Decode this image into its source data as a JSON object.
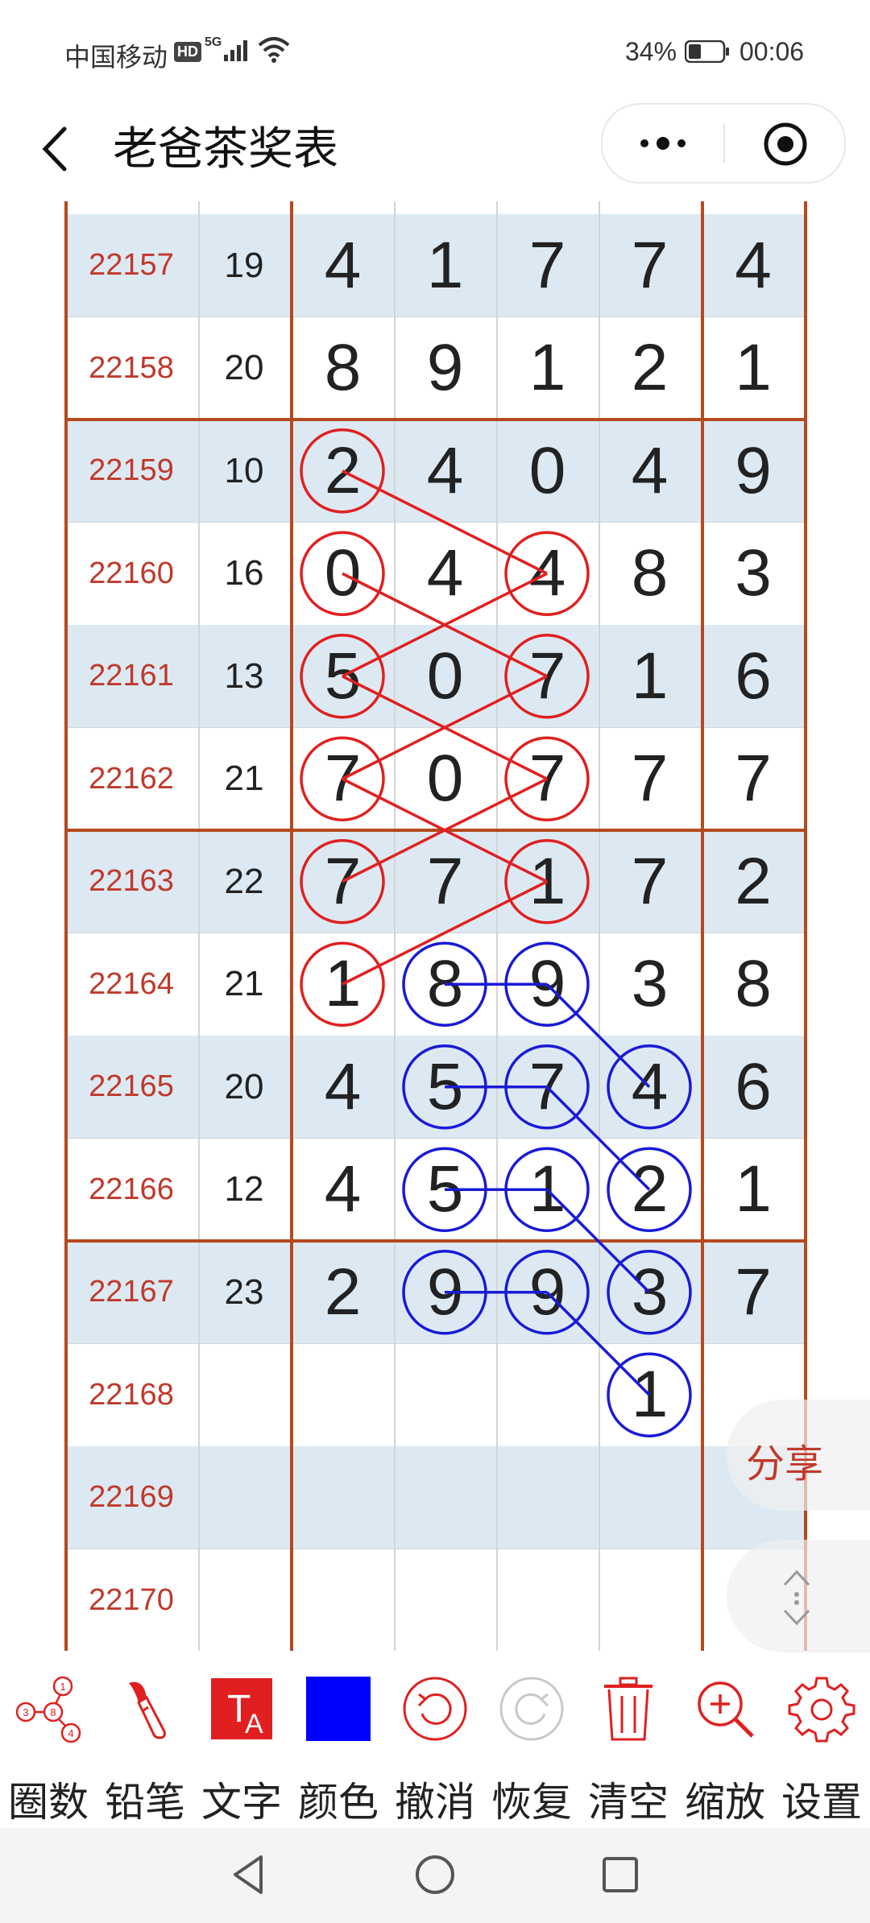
{
  "status_bar": {
    "carrier": "中国移动",
    "hd": "HD",
    "network": "5G",
    "battery_pct": "34%",
    "time": "00:06"
  },
  "title_bar": {
    "title": "老爸茶奖表"
  },
  "rows": [
    {
      "period": "22157",
      "sum": "19",
      "digits": [
        "4",
        "1",
        "7",
        "7"
      ],
      "extra": "4"
    },
    {
      "period": "22158",
      "sum": "20",
      "digits": [
        "8",
        "9",
        "1",
        "2"
      ],
      "extra": "1"
    },
    {
      "period": "22159",
      "sum": "10",
      "digits": [
        "2",
        "4",
        "0",
        "4"
      ],
      "extra": "9"
    },
    {
      "period": "22160",
      "sum": "16",
      "digits": [
        "0",
        "4",
        "4",
        "8"
      ],
      "extra": "3"
    },
    {
      "period": "22161",
      "sum": "13",
      "digits": [
        "5",
        "0",
        "7",
        "1"
      ],
      "extra": "6"
    },
    {
      "period": "22162",
      "sum": "21",
      "digits": [
        "7",
        "0",
        "7",
        "7"
      ],
      "extra": "7"
    },
    {
      "period": "22163",
      "sum": "22",
      "digits": [
        "7",
        "7",
        "1",
        "7"
      ],
      "extra": "2"
    },
    {
      "period": "22164",
      "sum": "21",
      "digits": [
        "1",
        "8",
        "9",
        "3"
      ],
      "extra": "8"
    },
    {
      "period": "22165",
      "sum": "20",
      "digits": [
        "4",
        "5",
        "7",
        "4"
      ],
      "extra": "6"
    },
    {
      "period": "22166",
      "sum": "12",
      "digits": [
        "4",
        "5",
        "1",
        "2"
      ],
      "extra": "1"
    },
    {
      "period": "22167",
      "sum": "23",
      "digits": [
        "2",
        "9",
        "9",
        "3"
      ],
      "extra": "7"
    },
    {
      "period": "22168",
      "sum": "",
      "digits": [
        "",
        "",
        "",
        "1"
      ],
      "extra": ""
    },
    {
      "period": "22169",
      "sum": "",
      "digits": [
        "",
        "",
        "",
        ""
      ],
      "extra": ""
    },
    {
      "period": "22170",
      "sum": "",
      "digits": [
        "",
        "",
        "",
        ""
      ],
      "extra": ""
    }
  ],
  "floating": {
    "share_label": "分享"
  },
  "toolbar": [
    {
      "label": "圈数",
      "icon": "circle-numbers-icon"
    },
    {
      "label": "铅笔",
      "icon": "brush-icon"
    },
    {
      "label": "文字",
      "icon": "text-icon"
    },
    {
      "label": "颜色",
      "icon": "color-swatch-icon"
    },
    {
      "label": "撤消",
      "icon": "undo-icon"
    },
    {
      "label": "恢复",
      "icon": "redo-icon"
    },
    {
      "label": "清空",
      "icon": "trash-icon"
    },
    {
      "label": "缩放",
      "icon": "zoom-in-icon"
    },
    {
      "label": "设置",
      "icon": "gear-icon"
    }
  ],
  "colors": {
    "accent_red": "#e02020",
    "annotation_blue": "#1a1ad6",
    "border_brown": "#b5491f",
    "row_blue": "#dde9f2",
    "selected_color": "#0000ff"
  }
}
